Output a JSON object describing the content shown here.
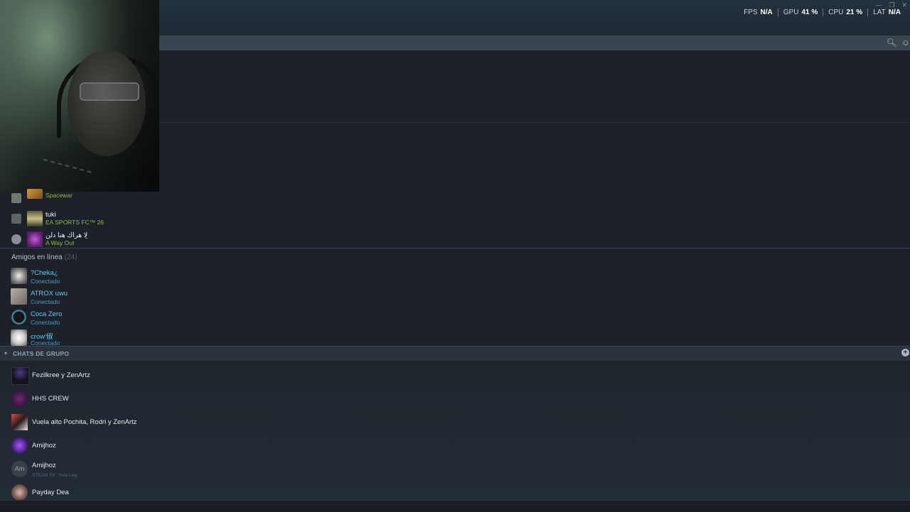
{
  "perf_overlay": {
    "items": [
      {
        "label": "FPS",
        "value": "N/A"
      },
      {
        "label": "GPU",
        "value": "41 %"
      },
      {
        "label": "CPU",
        "value": "21 %"
      },
      {
        "label": "LAT",
        "value": "N/A"
      }
    ]
  },
  "window_controls": {
    "minimize": "—",
    "maximize": "❐",
    "close": "✕"
  },
  "search": {
    "icon": "search-icon",
    "add_friend_icon": "add-friend-icon"
  },
  "in_game": [
    {
      "name": "",
      "game": "Spacewar"
    },
    {
      "name": "tuki",
      "game": "EA SPORTS FC™ 26"
    },
    {
      "name": "لِا هراك هنا دلن",
      "game": "A Way Out"
    }
  ],
  "online": {
    "header": "Amigos en línea",
    "count": "(24)",
    "friends": [
      {
        "name": "?Cheka¿",
        "status": "Conectado"
      },
      {
        "name": "ATROX uwu",
        "status": "Conectado"
      },
      {
        "name": "Coca Zero",
        "status": "Conectado"
      },
      {
        "name": "crow'俶",
        "status": "Conectado"
      }
    ]
  },
  "group_chats": {
    "header": "CHATS DE GRUPO",
    "items": [
      {
        "name": "Fezilkree y ZenArtz",
        "sub": ""
      },
      {
        "name": "HHS CREW",
        "sub": ""
      },
      {
        "name": "Vuela alto Pochita, Rodri y ZenArtz",
        "sub": ""
      },
      {
        "name": "Amijhoz",
        "sub": ""
      },
      {
        "name": "Amijhoz",
        "sub": "STEAM TV : Yule Log",
        "badge": "Am"
      },
      {
        "name": "Payday Dea",
        "sub": ""
      }
    ]
  },
  "colors": {
    "online_name": "#62c6f5",
    "ingame_game": "#90ba3c",
    "background": "#1d2129"
  }
}
